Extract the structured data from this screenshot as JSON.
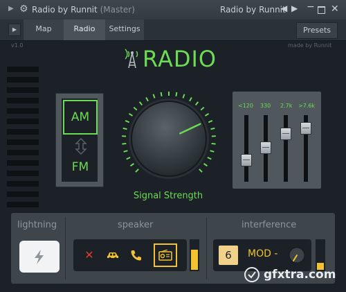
{
  "titlebar": {
    "title": "Radio by Runnit",
    "context": "(Master)",
    "right_title": "Radio by Runnit",
    "nav_prev": "◀",
    "nav_next": "▶",
    "minimize": "−",
    "close": "✕"
  },
  "tabs": [
    {
      "label": "Map"
    },
    {
      "label": "Radio"
    },
    {
      "label": "Settings"
    }
  ],
  "presets_label": "Presets",
  "header": {
    "version": "v1.0",
    "made_by": "made by Runnit",
    "title": "RADIO"
  },
  "band": {
    "am_label": "AM",
    "fm_label": "FM",
    "selected": "AM"
  },
  "signal": {
    "label": "Signal Strength",
    "knob_value": 0.74
  },
  "eq": {
    "bands": [
      {
        "label": "<120",
        "value": 0.3
      },
      {
        "label": "330",
        "value": 0.52
      },
      {
        "label": "2.7k",
        "value": 0.78
      },
      {
        "label": ">7.6k",
        "value": 0.88
      }
    ]
  },
  "bottom": {
    "lightning": {
      "title": "lightning"
    },
    "speaker": {
      "title": "speaker",
      "icons": [
        "close-icon",
        "car-icon",
        "phone-icon",
        "radio-icon"
      ],
      "selected": "radio-icon",
      "level": 0.7
    },
    "interference": {
      "title": "interference",
      "value": "6",
      "mod_label": "MOD -",
      "level": 0.25
    }
  },
  "watermark": "gfxtra.com",
  "colors": {
    "accent_green": "#6ddc55",
    "accent_yellow": "#f2c230",
    "background": "#1b2126",
    "panel": "#50575d"
  }
}
